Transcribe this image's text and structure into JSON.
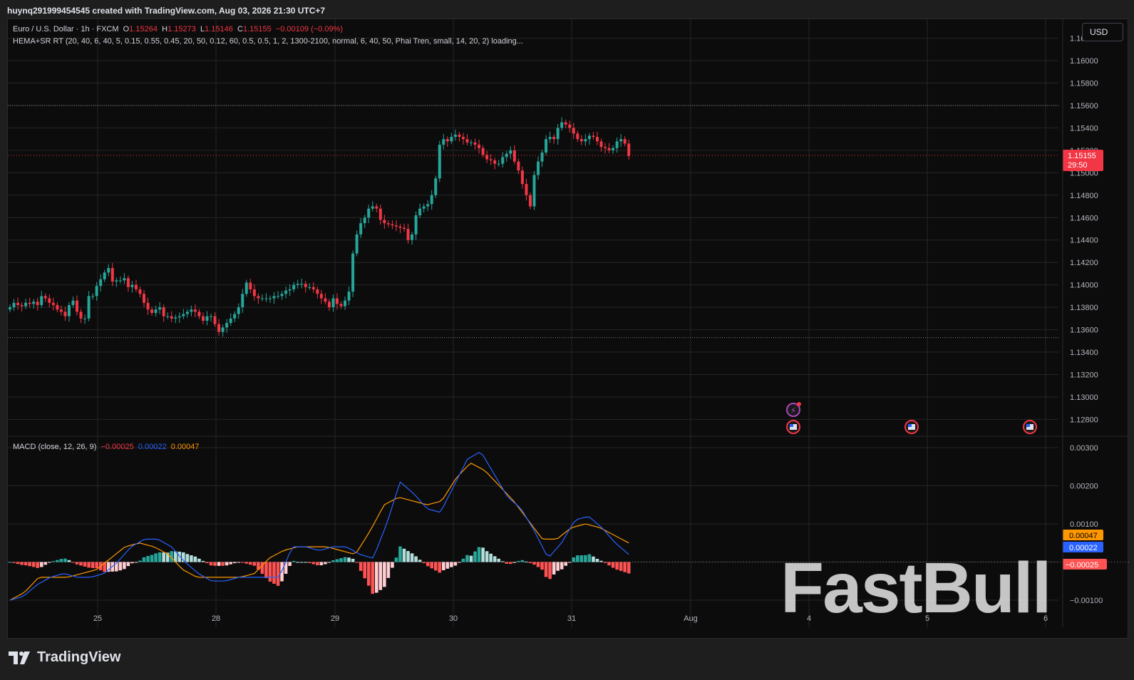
{
  "header": {
    "text": "huynq291999454545 created with TradingView.com, Aug 03, 2026 21:30 UTC+7"
  },
  "legend": {
    "symbol": "Euro / U.S. Dollar · 1h · FXCM",
    "o_label": "O",
    "o_value": "1.15264",
    "h_label": "H",
    "h_value": "1.15273",
    "l_label": "L",
    "l_value": "1.15146",
    "c_label": "C",
    "c_value": "1.15155",
    "change": "−0.00109 (−0.09%)",
    "indicator": "HEMA+SR RT (20, 40, 6, 40, 5, 0.15, 0.55, 0.45, 20, 50, 0.12, 60, 0.5, 0.5, 1, 2, 1300-2100, normal, 6, 40, 50, Phai Tren, small, 14, 20, 2) loading..."
  },
  "macd_legend": {
    "label": "MACD (close, 12, 26, 9)",
    "hist": "−0.00025",
    "macd": "0.00022",
    "signal": "0.00047"
  },
  "currency": "USD",
  "price_badge": {
    "price": "1.15155",
    "countdown": "29:50"
  },
  "macd_badges": {
    "signal": "0.00047",
    "macd": "0.00022",
    "hist": "−0.00025"
  },
  "brand": "TradingView",
  "watermark": "FastBull",
  "colors": {
    "up": "#26a69a",
    "down": "#f23645",
    "macd": "#2962ff",
    "signal": "#ff9800",
    "hist_up": "#26a69a",
    "hist_down": "#ff5252"
  },
  "chart_data": {
    "type": "candlestick",
    "price_axis": {
      "ticks": [
        "1.16200",
        "1.16000",
        "1.15800",
        "1.15600",
        "1.15400",
        "1.15200",
        "1.15000",
        "1.14800",
        "1.14600",
        "1.14400",
        "1.14200",
        "1.14000",
        "1.13800",
        "1.13600",
        "1.13400",
        "1.13200",
        "1.13000",
        "1.12800"
      ],
      "range": [
        1.1265,
        1.1635
      ]
    },
    "x_axis": {
      "ticks": [
        "25",
        "28",
        "29",
        "30",
        "31",
        "Aug",
        "4",
        "5",
        "6"
      ]
    },
    "price_path": [
      [
        1.138,
        1.1384,
        1.1382,
        1.1381,
        1.1384,
        1.1383,
        1.1385,
        1.1382,
        1.139,
        1.1388,
        1.1384,
        1.1382,
        1.1378,
        1.1376,
        1.1372,
        1.1382,
        1.1386,
        1.1376,
        1.137,
        1.137
      ],
      [
        1.139,
        1.139,
        1.1399,
        1.1405,
        1.1411,
        1.1415,
        1.1403,
        1.1404,
        1.1404,
        1.1406,
        1.1398,
        1.14,
        1.1396,
        1.1392,
        1.1384,
        1.1378,
        1.1375,
        1.1378,
        1.138,
        1.1372,
        1.1372,
        1.137,
        1.1371,
        1.1372,
        1.1374,
        1.1376,
        1.1378,
        1.1376,
        1.1372,
        1.1368,
        1.1372,
        1.1372,
        1.1365,
        1.1358,
        1.1362,
        1.1366,
        1.137,
        1.1374,
        1.138,
        1.1392,
        1.1402,
        1.1396,
        1.139,
        1.1388,
        1.1388,
        1.1388,
        1.1388,
        1.139,
        1.139,
        1.1392,
        1.1395,
        1.1396,
        1.14,
        1.1401,
        1.1401,
        1.1398,
        1.1398,
        1.1396,
        1.1392,
        1.1388,
        1.1385,
        1.138,
        1.1388,
        1.1383,
        1.1381,
        1.1386,
        1.1394,
        1.1428,
        1.1445,
        1.1455,
        1.146,
        1.1468,
        1.147,
        1.1468,
        1.1458,
        1.1455,
        1.1454,
        1.1453,
        1.1452,
        1.1451,
        1.145,
        1.144,
        1.1445,
        1.1462,
        1.1468,
        1.147,
        1.1472,
        1.148,
        1.1495,
        1.1525,
        1.153,
        1.1528,
        1.1532,
        1.1534,
        1.1532,
        1.153,
        1.1527,
        1.1527,
        1.1525,
        1.1522,
        1.1516,
        1.1512,
        1.1511,
        1.1508,
        1.1508,
        1.1514,
        1.1517,
        1.152,
        1.151,
        1.1502,
        1.149,
        1.148,
        1.147,
        1.1498,
        1.151,
        1.1518,
        1.153,
        1.1532,
        1.153,
        1.154,
        1.1545,
        1.1543,
        1.154,
        1.1535,
        1.153,
        1.1528,
        1.153,
        1.1533,
        1.1532,
        1.1528,
        1.1523,
        1.1522,
        1.152,
        1.1522,
        1.1528,
        1.153,
        1.1526,
        1.1515
      ]
    ],
    "last_price": 1.15155,
    "macd": {
      "ticks": [
        "0.00300",
        "0.00200",
        "0.00100",
        "0.00000",
        "−0.00100"
      ],
      "range": [
        -0.0013,
        0.0033
      ],
      "macd_line": [
        -0.001,
        -0.0009,
        -0.0006,
        -0.0004,
        -0.0003,
        -0.0004,
        -0.0004,
        -0.0003,
        0.0,
        0.0004,
        0.0006,
        0.0006,
        0.0004,
        0.0,
        -0.0003,
        -0.0005,
        -0.0005,
        -0.0004,
        -0.0004,
        -0.0004,
        -0.0004,
        0.0004,
        0.0004,
        0.0003,
        0.0004,
        0.0004,
        0.0002,
        0.0001,
        0.001,
        0.0021,
        0.0018,
        0.0014,
        0.0013,
        0.002,
        0.0027,
        0.0029,
        0.0023,
        0.0017,
        0.0014,
        0.0008,
        0.0001,
        0.0005,
        0.0011,
        0.0012,
        0.0009,
        0.0005,
        0.0002
      ],
      "signal_line": [
        -0.001,
        -0.0008,
        -0.0004,
        -0.0004,
        -0.0004,
        -0.0003,
        -0.0002,
        0.0001,
        0.0004,
        0.0005,
        0.0004,
        0.0002,
        -0.0002,
        -0.0004,
        -0.0004,
        -0.0004,
        -0.0004,
        -0.0003,
        0.0001,
        0.0003,
        0.0004,
        0.0004,
        0.0004,
        0.0003,
        0.0002,
        0.0008,
        0.0015,
        0.0017,
        0.0016,
        0.0015,
        0.0016,
        0.0022,
        0.0026,
        0.0024,
        0.002,
        0.0016,
        0.0011,
        0.0006,
        0.0006,
        0.0009,
        0.001,
        0.0009,
        0.0007,
        0.0005
      ],
      "histogram_profile": "mixed positive/negative bars",
      "last_hist": -0.00025
    }
  }
}
